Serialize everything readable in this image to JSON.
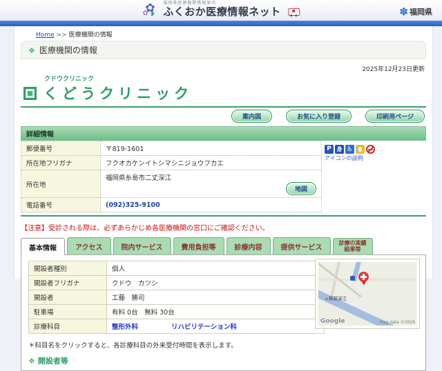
{
  "theme": {
    "accent_green": "#2f9e68",
    "bar_blue": "#2e64c8",
    "link_blue": "#2244cc",
    "notice_red": "#cc1111",
    "tab_green": "#a9dcb2"
  },
  "header": {
    "site_subtitle": "福岡県医療機関情報案内",
    "site_title": "ふくおか医療情報ネット",
    "pref_name": "福岡県"
  },
  "breadcrumb": {
    "home": "Home",
    "separator": ">>",
    "current": "医療機関の情報"
  },
  "page": {
    "section_title": "医療機関の情報",
    "updated": "2025年12月23日更新"
  },
  "clinic": {
    "furigana": "クドウクリニック",
    "name": "くどうクリニック"
  },
  "actions": {
    "guide_map": "案内図",
    "favorite": "お気に入り登録",
    "print": "印刷用ページ"
  },
  "detail": {
    "title": "詳細情報",
    "rows": [
      {
        "label": "郵便番号",
        "value": "〒819-1601"
      },
      {
        "label": "所在地フリガナ",
        "value": "フクオカケンイトシマシニジョウフカエ"
      },
      {
        "label": "所在地",
        "value": "福岡県糸島市二丈深江"
      },
      {
        "label": "電話番号",
        "value": "(092)325-9100"
      }
    ],
    "map_button": "地図",
    "icons": {
      "legend": "アイコンの説明",
      "items": [
        {
          "name": "parking",
          "glyph": "P"
        },
        {
          "name": "support",
          "glyph": "身"
        },
        {
          "name": "wheelchair",
          "glyph": "♿"
        },
        {
          "name": "ostomate",
          "glyph": ""
        },
        {
          "name": "no-smoking",
          "glyph": ""
        }
      ]
    }
  },
  "notice": "【注意】受診される際は、必ずあらかじめ各医療機関の窓口にご確認ください。",
  "tabs": [
    {
      "label": "基本情報",
      "active": true
    },
    {
      "label": "アクセス",
      "active": false
    },
    {
      "label": "院内サービス",
      "active": false
    },
    {
      "label": "費用負担等",
      "active": false
    },
    {
      "label": "診療内容",
      "active": false
    },
    {
      "label": "提供サービス",
      "active": false
    },
    {
      "line1": "診療の実績",
      "line2": "結果等",
      "active": false
    }
  ],
  "basic": {
    "rows": [
      {
        "label": "開設者種別",
        "value": "個人"
      },
      {
        "label": "開設者フリガナ",
        "value": "クドウ　カツシ"
      },
      {
        "label": "開設者",
        "value": "工藤　勝司"
      },
      {
        "label": "駐車場",
        "value": "有料 0台　無料 30台"
      }
    ],
    "dept_label": "診療科目",
    "departments": [
      "整形外科",
      "リハビリテーション科"
    ]
  },
  "map": {
    "station": "筑前深江",
    "brand": "Google",
    "copyright": "Map data ©2026"
  },
  "note": "＊科目名をクリックすると、各診療科目の外来受付時間を表示します。",
  "bottom_section": "開設者等"
}
